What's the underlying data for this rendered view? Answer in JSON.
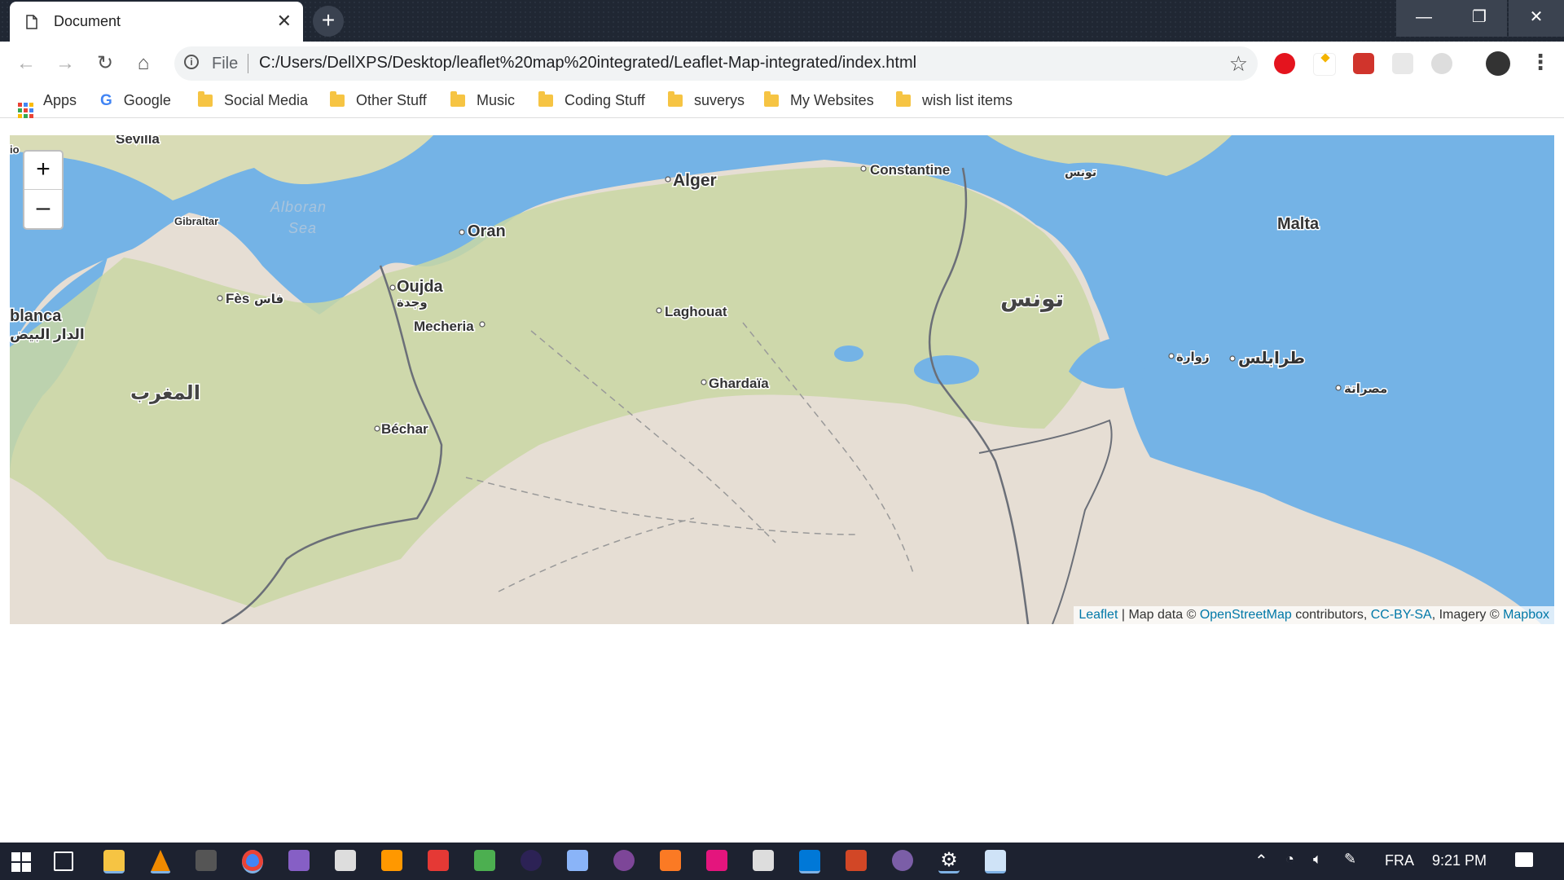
{
  "browser": {
    "tab_title": "Document",
    "tab_close": "✕",
    "new_tab": "+",
    "window_controls": {
      "minimize": "—",
      "restore": "❐",
      "close": "✕"
    },
    "nav": {
      "back": "←",
      "forward": "→",
      "reload": "↻",
      "home": "⌂"
    },
    "omnibox": {
      "info": "i",
      "scheme_label": "File",
      "url": "C:/Users/DellXPS/Desktop/leaflet%20map%20integrated/Leaflet-Map-integrated/index.html",
      "star": "☆"
    },
    "extensions": [
      "ublock-icon",
      "css-icon",
      "cors-icon",
      "extension-icon",
      "extension-icon",
      "profile-avatar"
    ],
    "menu": "⋮"
  },
  "bookmarks": [
    {
      "label": "Apps",
      "icon": "apps-grid-icon"
    },
    {
      "label": "Google",
      "icon": "google-icon"
    },
    {
      "label": "Social Media",
      "icon": "folder-icon"
    },
    {
      "label": "Other Stuff",
      "icon": "folder-icon"
    },
    {
      "label": "Music",
      "icon": "folder-icon"
    },
    {
      "label": "Coding Stuff",
      "icon": "folder-icon"
    },
    {
      "label": "suverys",
      "icon": "folder-icon"
    },
    {
      "label": "My Websites",
      "icon": "folder-icon"
    },
    {
      "label": "wish list items",
      "icon": "folder-icon"
    }
  ],
  "map": {
    "zoom_in": "+",
    "zoom_out": "–",
    "labels": {
      "sevilla": "Sevilla",
      "gibraltar": "Gibraltar",
      "alboran": "Alboran",
      "sea": "Sea",
      "oran": "Oran",
      "alger": "Alger",
      "constantine": "Constantine",
      "tunis_latin": "تونس",
      "malta": "Malta",
      "oujda": "Oujda",
      "oujda_ar": "وجدة",
      "fes": "Fès",
      "fes_ar": "فاس",
      "casablanca": "blanca",
      "casablanca_ar": "الدار البيض",
      "mecheria": "Mecheria",
      "laghouat": "Laghouat",
      "tunisia_ar": "تونس",
      "zuwara_ar": "زوارة",
      "tripoli_ar": "طرابلس",
      "misrata_ar": "مصراتة",
      "ghardaia": "Ghardaïa",
      "morocco_ar": "المغرب",
      "bechar": "Béchar",
      "lisbon_fragment": "io"
    },
    "attribution": {
      "leaflet": "Leaflet",
      "sep1": " | Map data © ",
      "osm": "OpenStreetMap",
      "contributors": " contributors, ",
      "license": "CC-BY-SA",
      "imagery": ", Imagery © ",
      "mapbox": "Mapbox"
    },
    "colors": {
      "water": "#74b3e6",
      "land": "#e6ded4",
      "green": "#c7d6a2",
      "border": "#6b6f78"
    }
  },
  "taskbar": {
    "language": "FRA",
    "time": "9:21 PM",
    "apps": [
      "start-icon",
      "task-view-icon",
      "file-explorer-icon",
      "vlc-icon",
      "kali-icon",
      "chrome-icon",
      "visual-studio-icon",
      "unity-icon",
      "sublime-icon",
      "popcorn-icon",
      "git-kraken-icon",
      "eclipse-icon",
      "box-icon",
      "tor-icon",
      "xampp-icon",
      "intellij-icon",
      "calendar-icon",
      "vscode-icon",
      "powerpoint-icon",
      "eclipse-ee-icon",
      "settings-icon",
      "paint-icon"
    ]
  }
}
